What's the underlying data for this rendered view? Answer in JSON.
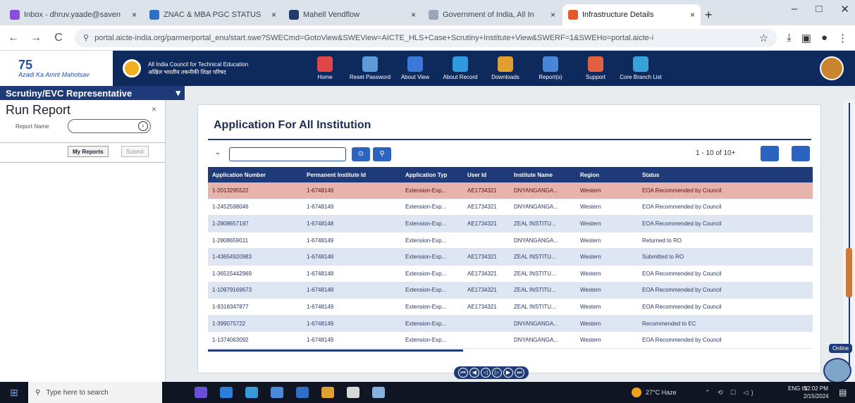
{
  "browser": {
    "tabs": [
      {
        "label": "Inbox - dhruv.yaade@saven",
        "favicon_color": "#8a4fd8",
        "active": false
      },
      {
        "label": "ZNAC & MBA PGC STATUS",
        "favicon_color": "#2b72c4",
        "active": false
      },
      {
        "label": "Mahell Vendflow",
        "favicon_color": "#223a6b",
        "active": false
      },
      {
        "label": "Government of India, All In",
        "favicon_color": "#9aa7b8",
        "active": false
      },
      {
        "label": "Infrastructure Details",
        "favicon_color": "#e05a2a",
        "active": true
      }
    ],
    "tab_close": "×",
    "new_tab": "+",
    "window_controls": [
      "–",
      "□",
      "✕"
    ],
    "url": "portal.aicte-india.org/parmerportal_enu/start.swe?SWECmd=GotoView&SWEView=AICTE_HLS+Case+Scrutiny+Institute+View&SWERF=1&SWEHo=portal.aicte-i",
    "nav_back": "←",
    "nav_forward": "→",
    "nav_reload": "C",
    "lock_icon": "⚲",
    "bookmark_icon": "☆",
    "download_icon": "⤓",
    "sidepanel_icon": "▣",
    "profile_icon": "●",
    "menu_icon": "⋮"
  },
  "header": {
    "logo_line1": "75",
    "logo_line2": "Azadi Ka Amrit Mahotsav",
    "org_line1": "All India Council for Technical Education",
    "org_line2": "अखिल भारतीय तकनीकी शिक्षा परिषद",
    "nav": [
      {
        "label": "Home",
        "color": "#e04848"
      },
      {
        "label": "Reset Password",
        "color": "#5b9bd8"
      },
      {
        "label": "About View",
        "color": "#3a78d8"
      },
      {
        "label": "About Record",
        "color": "#2f9adf"
      },
      {
        "label": "Downloads",
        "color": "#e0a030"
      },
      {
        "label": "Report(s)",
        "color": "#4a86d8"
      },
      {
        "label": "Support",
        "color": "#e06040"
      },
      {
        "label": "Core Branch List",
        "color": "#3aa0d8"
      }
    ]
  },
  "role_bar": {
    "label": "Scrutiny/EVC Representative",
    "caret": "▾"
  },
  "sidebar": {
    "title": "Run Report",
    "close": "×",
    "report_name_label": "Report Name",
    "my_reports": "My Reports",
    "submit": "Submit"
  },
  "panel": {
    "title": "Application For All Institution",
    "dropdown": "⌄",
    "go_label": "Go",
    "find_label": "Find",
    "pager": "1 - 10 of 10+",
    "columns": [
      "Application Number",
      "Permanent Institute Id",
      "Application Typ",
      "User Id",
      "Institute Name",
      "Region",
      "Status"
    ],
    "rows": [
      [
        "1-2013295522",
        "1-6748149",
        "Extension-Exp...",
        "AE1734321",
        "DNYANGANGA...",
        "Western",
        "EOA Recommended by Council"
      ],
      [
        "1-2452598046",
        "1-6748149",
        "Extension-Exp...",
        "AE1734321",
        "DNYANGANGA...",
        "Western",
        "EOA Recommended by Council"
      ],
      [
        "1-2808657197",
        "1-6748148",
        "Extension-Exp...",
        "AE1734321",
        "ZEAL INSTITU...",
        "Western",
        "EOA Recommended by Council"
      ],
      [
        "1-2808659011",
        "1-6748149",
        "Extension-Exp...",
        "",
        "DNYANGANGA...",
        "Western",
        "Returned to RO"
      ],
      [
        "1-43654920983",
        "1-6748148",
        "Extension-Exp...",
        "AE1734321",
        "ZEAL INSTITU...",
        "Western",
        "Submitted to RO"
      ],
      [
        "1-36515442969",
        "1-6748148",
        "Extension-Exp...",
        "AE1734321",
        "ZEAL INSTITU...",
        "Western",
        "EOA Recommended by Council"
      ],
      [
        "1-10979169673",
        "1-6748148",
        "Extension-Exp...",
        "AE1734321",
        "ZEAL INSTITU...",
        "Western",
        "EOA Recommended by Council"
      ],
      [
        "1-9318347877",
        "1-6748149",
        "Extension-Exp...",
        "AE1734321",
        "ZEAL INSTITU...",
        "Western",
        "EOA Recommended by Council"
      ],
      [
        "1-399075722",
        "1-6748149",
        "Extension-Exp...",
        "",
        "DNYANGANGA...",
        "Western",
        "Recommended to EC"
      ],
      [
        "1-1374063092",
        "1-6748149",
        "Extension-Exp...",
        "",
        "DNYANGANGA...",
        "Western",
        "EOA Recommended by Council"
      ]
    ],
    "pagination": [
      "⏮",
      "◀",
      "◁",
      "▷",
      "▶",
      "⏭"
    ]
  },
  "chat": {
    "label": "Online"
  },
  "taskbar": {
    "start_icon": "⊞",
    "search_icon": "⚲",
    "search_placeholder": "Type here to search",
    "apps": [
      "#6a4fd8",
      "#2b7fd8",
      "#3a9ad8",
      "#4a8ad8",
      "#2f6ec4",
      "#e0a030",
      "#d8d8d8",
      "#8ab0e0"
    ],
    "weather": "27°C Haze",
    "tray": "⌃ ⟲ ☐ ◁)",
    "lang": "ENG IN",
    "time": "12:02 PM",
    "date": "2/15/2024",
    "notifications_icon": "▤"
  }
}
